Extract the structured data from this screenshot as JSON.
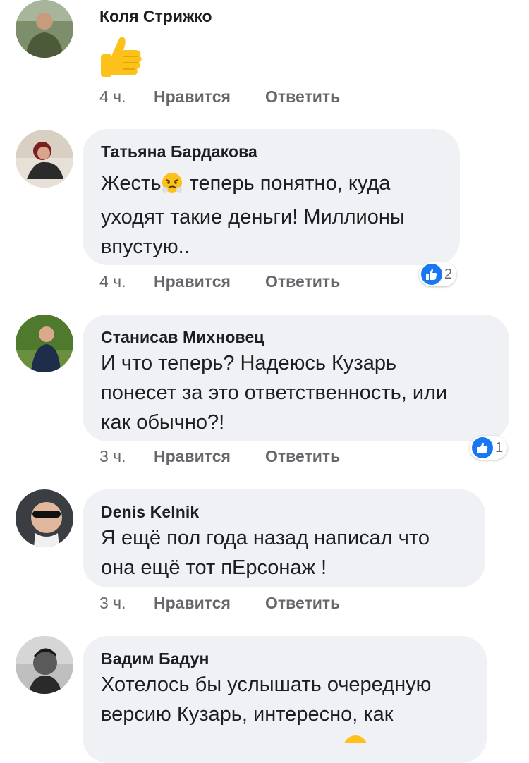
{
  "comments": [
    {
      "author": "Коля Стрижко",
      "content_emoji": "thumbs-up",
      "time": "4 ч.",
      "like_label": "Нравится",
      "reply_label": "Ответить"
    },
    {
      "author": "Татьяна Бардакова",
      "text_part1": "Жесть",
      "text_part2": " теперь понятно, куда\nуходят такие деньги! Миллионы\nвпустую..",
      "emoji": "steaming-face",
      "time": "4 ч.",
      "like_label": "Нравится",
      "reply_label": "Ответить",
      "reaction_count": "2"
    },
    {
      "author": "Станисав Михновец",
      "text": "И что теперь? Надеюсь Кузарь\nпонесет за это ответственность, или\nкак обычно?!",
      "time": "3 ч.",
      "like_label": "Нравится",
      "reply_label": "Ответить",
      "reaction_count": "1"
    },
    {
      "author": "Denis Kelnik",
      "text": "Я ещё пол года назад написал что\nона ещё тот пЕрсонаж !",
      "time": "3 ч.",
      "like_label": "Нравится",
      "reply_label": "Ответить"
    },
    {
      "author": "Вадим Бадун",
      "text": "Хотелось бы услышать очередную\nверсию Кузарь, интересно, как"
    }
  ],
  "colors": {
    "bubble": "#eff1f4",
    "action_text": "#65676b",
    "like_blue": "#1877f2"
  }
}
